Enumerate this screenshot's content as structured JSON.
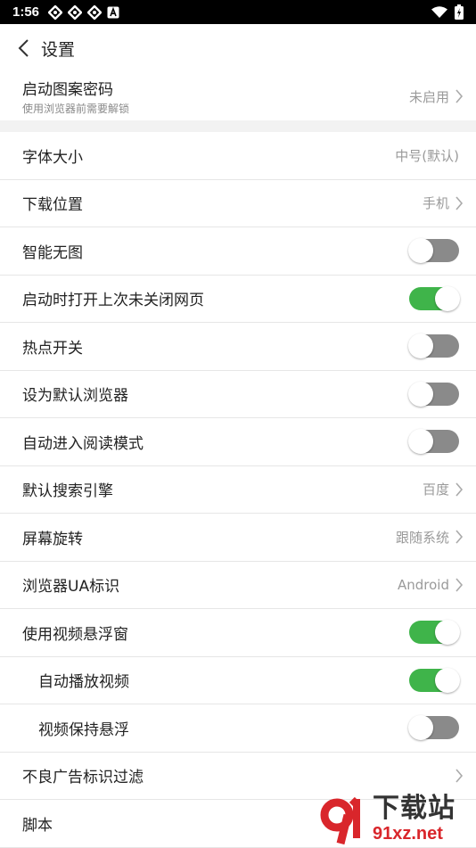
{
  "status": {
    "time": "1:56",
    "notif_icons": [
      "app-icon",
      "app-icon",
      "app-icon",
      "a-icon"
    ]
  },
  "header": {
    "title": "设置"
  },
  "lock": {
    "label": "启动图案密码",
    "hint": "使用浏览器前需要解锁",
    "value": "未启用"
  },
  "rows": [
    {
      "label": "字体大小",
      "value": "中号(默认)",
      "type": "value"
    },
    {
      "label": "下载位置",
      "value": "手机",
      "type": "nav"
    },
    {
      "label": "智能无图",
      "type": "toggle",
      "on": false
    },
    {
      "label": "启动时打开上次未关闭网页",
      "type": "toggle",
      "on": true
    },
    {
      "label": "热点开关",
      "type": "toggle",
      "on": false
    },
    {
      "label": "设为默认浏览器",
      "type": "toggle",
      "on": false
    },
    {
      "label": "自动进入阅读模式",
      "type": "toggle",
      "on": false
    },
    {
      "label": "默认搜索引擎",
      "value": "百度",
      "type": "nav"
    },
    {
      "label": "屏幕旋转",
      "value": "跟随系统",
      "type": "nav"
    },
    {
      "label": "浏览器UA标识",
      "value": "Android",
      "type": "nav"
    },
    {
      "label": "使用视频悬浮窗",
      "type": "toggle",
      "on": true
    },
    {
      "label": "自动播放视频",
      "type": "toggle",
      "on": true,
      "sub": true
    },
    {
      "label": "视频保持悬浮",
      "type": "toggle",
      "on": false,
      "sub": true
    },
    {
      "label": "不良广告标识过滤",
      "type": "nav",
      "value": ""
    },
    {
      "label": "脚本",
      "type": "plain"
    }
  ],
  "watermark": {
    "big": "下载站",
    "small": "91xz.net"
  },
  "colors": {
    "toggle_on": "#3fb44a",
    "toggle_off": "#8a8a8a",
    "watermark_red": "#d9262b"
  }
}
